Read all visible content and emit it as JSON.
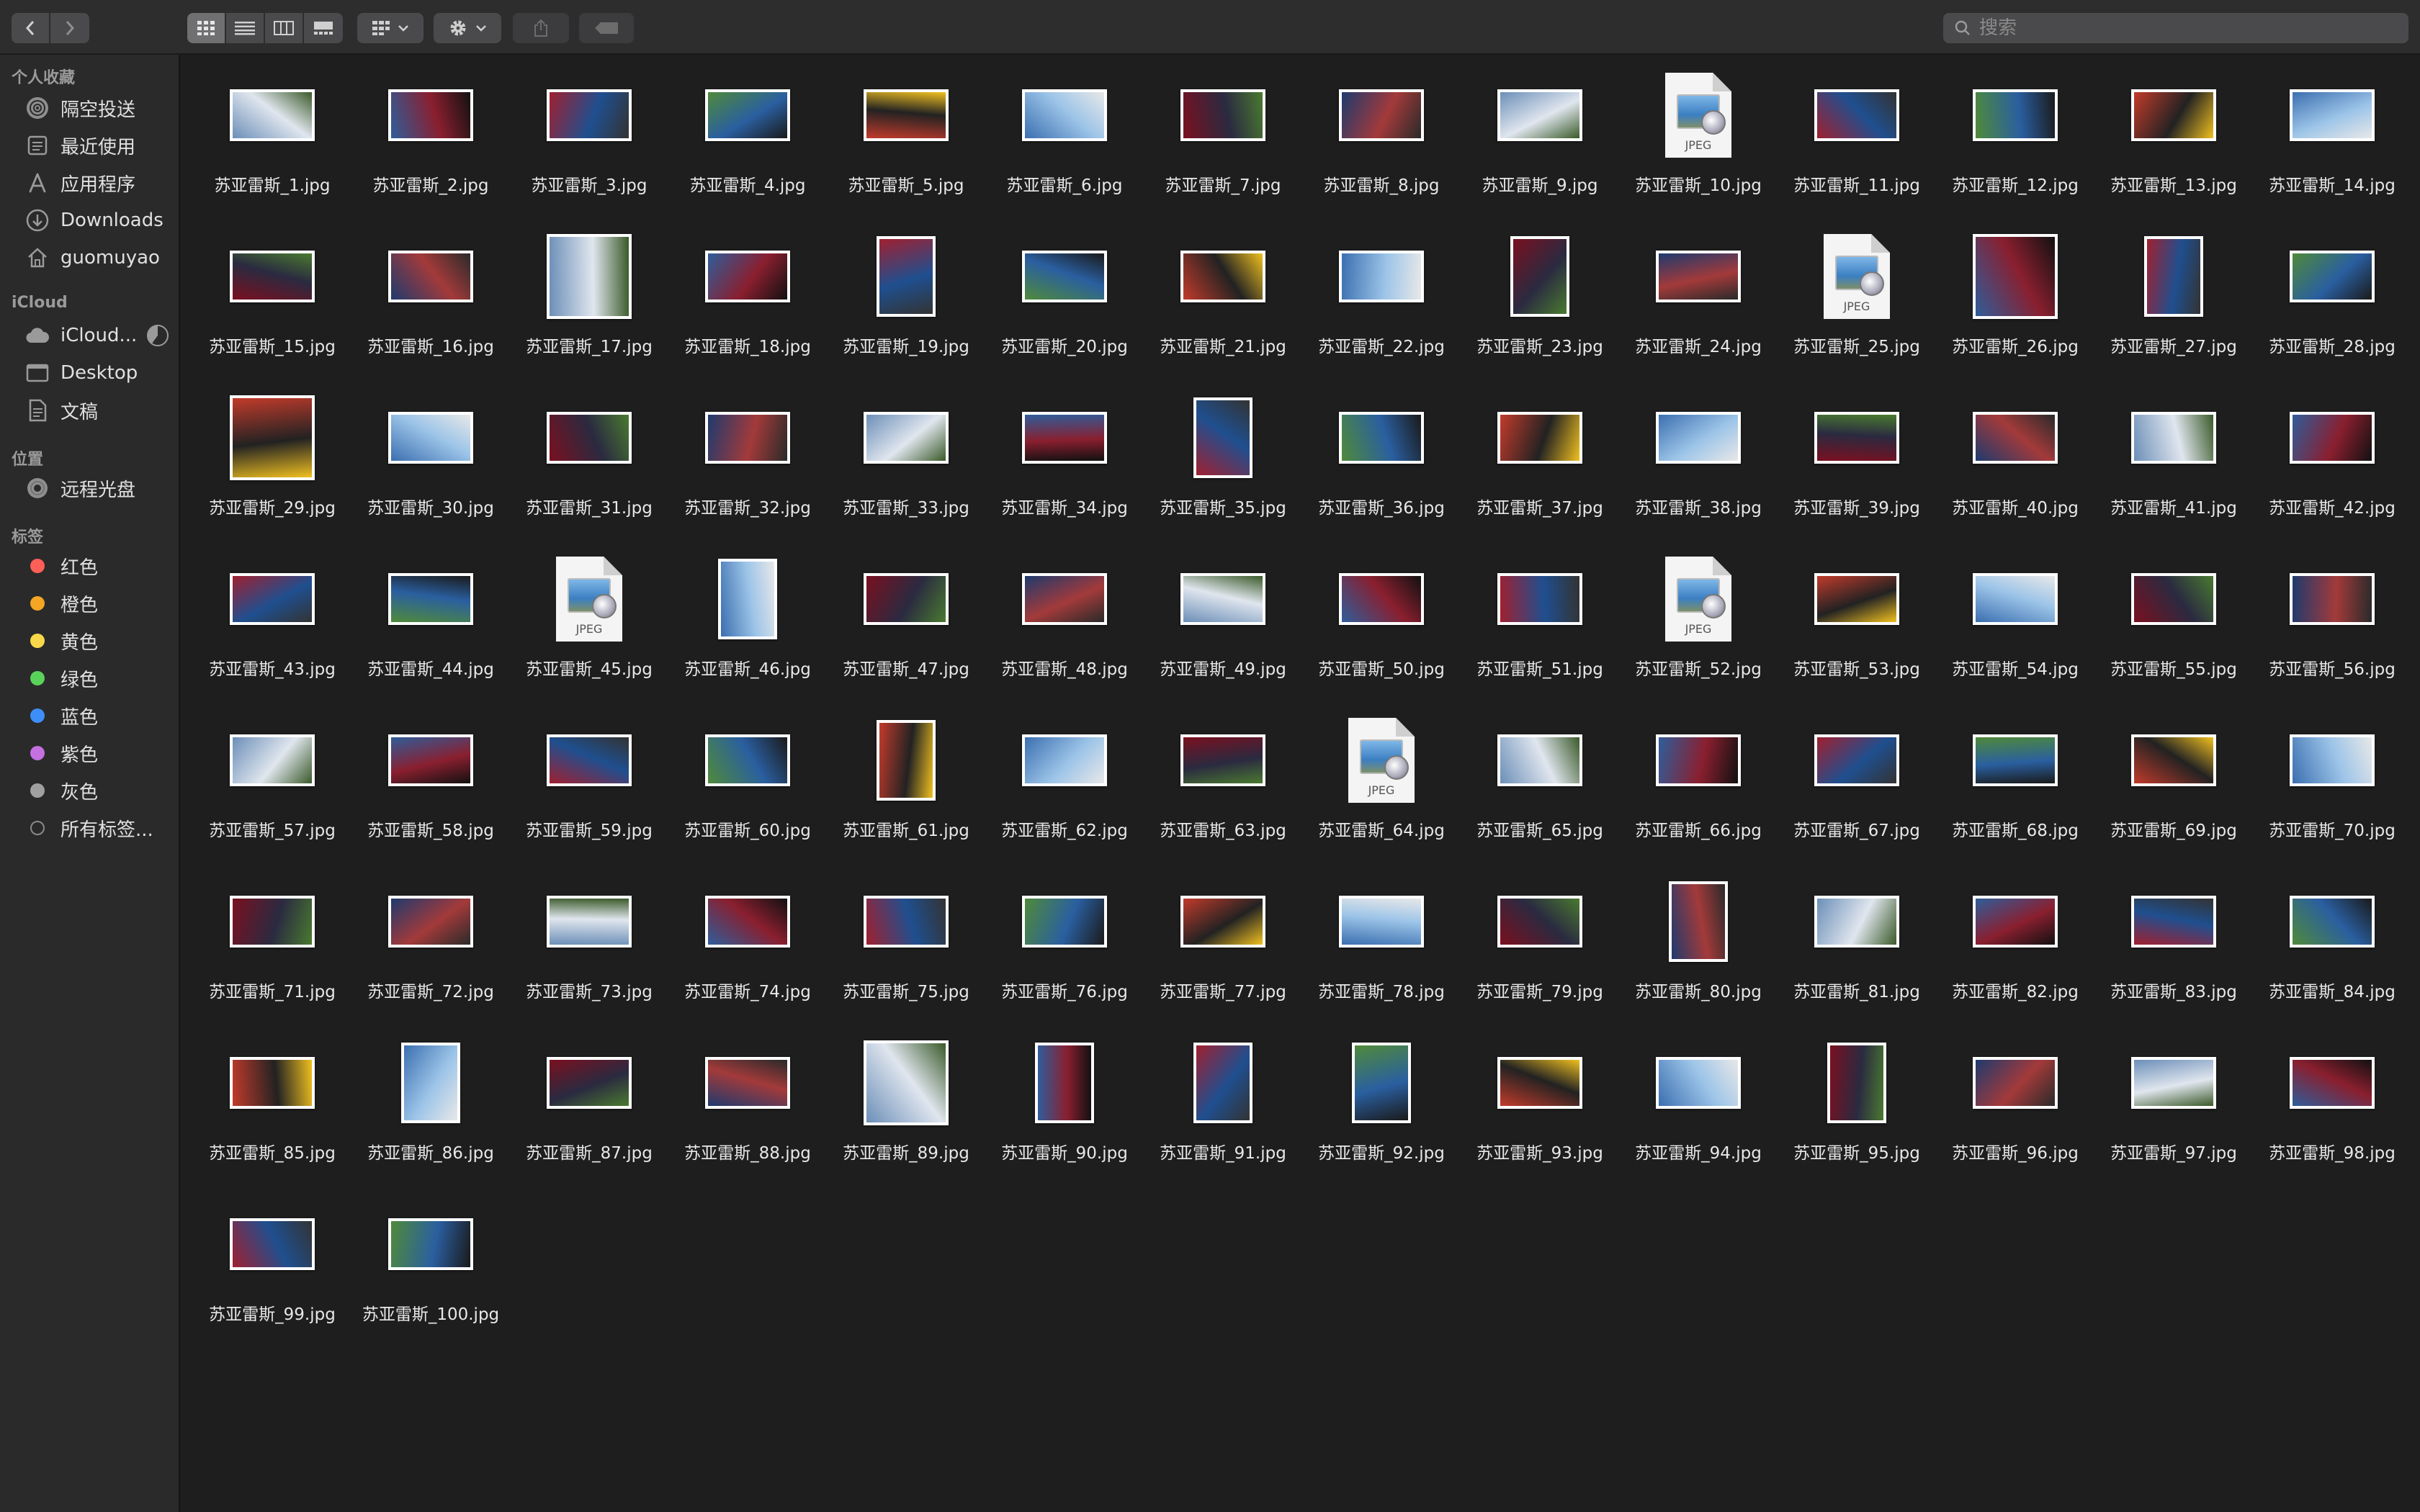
{
  "toolbar": {
    "search_placeholder": "搜索",
    "view_modes": [
      "icon-view",
      "list-view",
      "column-view",
      "gallery-view"
    ],
    "active_view": 0
  },
  "sidebar": {
    "favorites_heading": "个人收藏",
    "favorites": [
      {
        "label": "隔空投送",
        "icon": "airdrop-icon"
      },
      {
        "label": "最近使用",
        "icon": "recents-icon"
      },
      {
        "label": "应用程序",
        "icon": "applications-icon"
      },
      {
        "label": "Downloads",
        "icon": "downloads-icon"
      },
      {
        "label": "guomuyao",
        "icon": "home-icon"
      }
    ],
    "icloud_heading": "iCloud",
    "icloud": [
      {
        "label": "iCloud...",
        "icon": "icloud-drive-icon"
      },
      {
        "label": "Desktop",
        "icon": "desktop-folder-icon"
      },
      {
        "label": "文稿",
        "icon": "documents-icon"
      }
    ],
    "locations_heading": "位置",
    "locations": [
      {
        "label": "远程光盘",
        "icon": "remote-disc-icon"
      }
    ],
    "tags_heading": "标签",
    "tags": [
      {
        "label": "红色",
        "color": "#fe5f57"
      },
      {
        "label": "橙色",
        "color": "#f5a623"
      },
      {
        "label": "黄色",
        "color": "#f8d84a"
      },
      {
        "label": "绿色",
        "color": "#5ad25a"
      },
      {
        "label": "蓝色",
        "color": "#3e8ef7"
      },
      {
        "label": "紫色",
        "color": "#c470e0"
      },
      {
        "label": "灰色",
        "color": "#a0a0a0"
      },
      {
        "label": "所有标签...",
        "color": ""
      }
    ]
  },
  "files": {
    "name_prefix": "苏亚雷斯_",
    "extension": ".jpg",
    "count": 100,
    "generic_jpeg_icons": [
      10,
      25,
      45,
      52,
      64
    ],
    "generic_label": "JPEG",
    "portrait": [
      19,
      23,
      27,
      35,
      46,
      61,
      80,
      86,
      90,
      91,
      92,
      95
    ],
    "square": [
      17,
      26,
      29,
      89
    ]
  },
  "colors": {
    "window_bg": "#1e1e1e",
    "sidebar_bg": "#2a2a2b",
    "toolbar_bg": "#2d2d2e",
    "text": "#e8e8e8"
  }
}
